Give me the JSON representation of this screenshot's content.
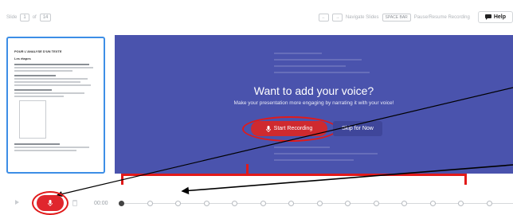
{
  "toolbar": {
    "slide_label": "Slide",
    "slide_current": "1",
    "slide_of": "of",
    "slide_total": "14",
    "nav_label": "Navigate Slides",
    "space_key": "SPACE BAR",
    "pause_label": "Pause/Resume Recording",
    "help_label": "Help"
  },
  "thumbnail": {
    "title": "POUR L'ANALYSE D'UN TEXTE",
    "subtitle": "Les étapes"
  },
  "overlay": {
    "title": "Want to add your voice?",
    "subtitle": "Make your presentation more engaging by narrating it with your voice!",
    "start_label": "Start Recording",
    "skip_label": "Skip for Now"
  },
  "timeline": {
    "time": "00:00",
    "slide_count": 14,
    "current_slide_index": 0
  },
  "colors": {
    "slide_bg": "#4a53ad",
    "record_red": "#cf2a2f",
    "annotation_red": "#e11a1a",
    "thumb_border": "#3d8ee6"
  },
  "icons": {
    "help": "chat-bubble-icon",
    "microphone": "microphone-icon",
    "play": "play-icon",
    "trash": "trash-icon",
    "prev": "arrow-left-icon",
    "next": "arrow-right-icon"
  }
}
